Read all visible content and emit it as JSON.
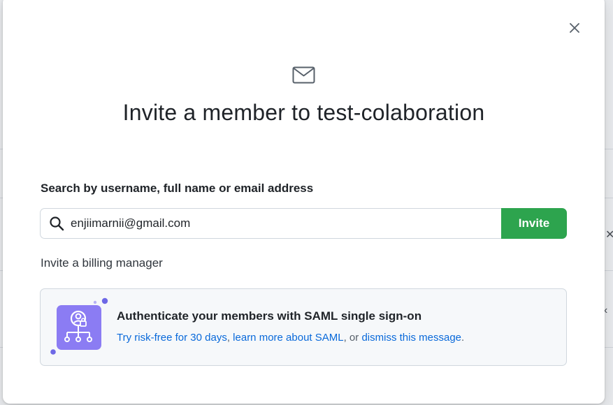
{
  "dialog": {
    "title": "Invite a member to test-colaboration",
    "close_icon": "close-icon",
    "mail_icon": "mail-icon"
  },
  "search": {
    "label": "Search by username, full name or email address",
    "value": "enjiimarnii@gmail.com",
    "icon": "search-icon",
    "invite_label": "Invite"
  },
  "billing": {
    "link_label": "Invite a billing manager"
  },
  "saml": {
    "title": "Authenticate your members with SAML single sign-on",
    "try_link": "Try risk-free for 30 days",
    "sep1": ",",
    "learn_link": "learn more about SAML",
    "sep2": ", or",
    "dismiss_link": "dismiss this message",
    "end": "."
  },
  "colors": {
    "accent_green": "#2da44e",
    "link_blue": "#0969da",
    "saml_purple": "#8a7cf0"
  }
}
